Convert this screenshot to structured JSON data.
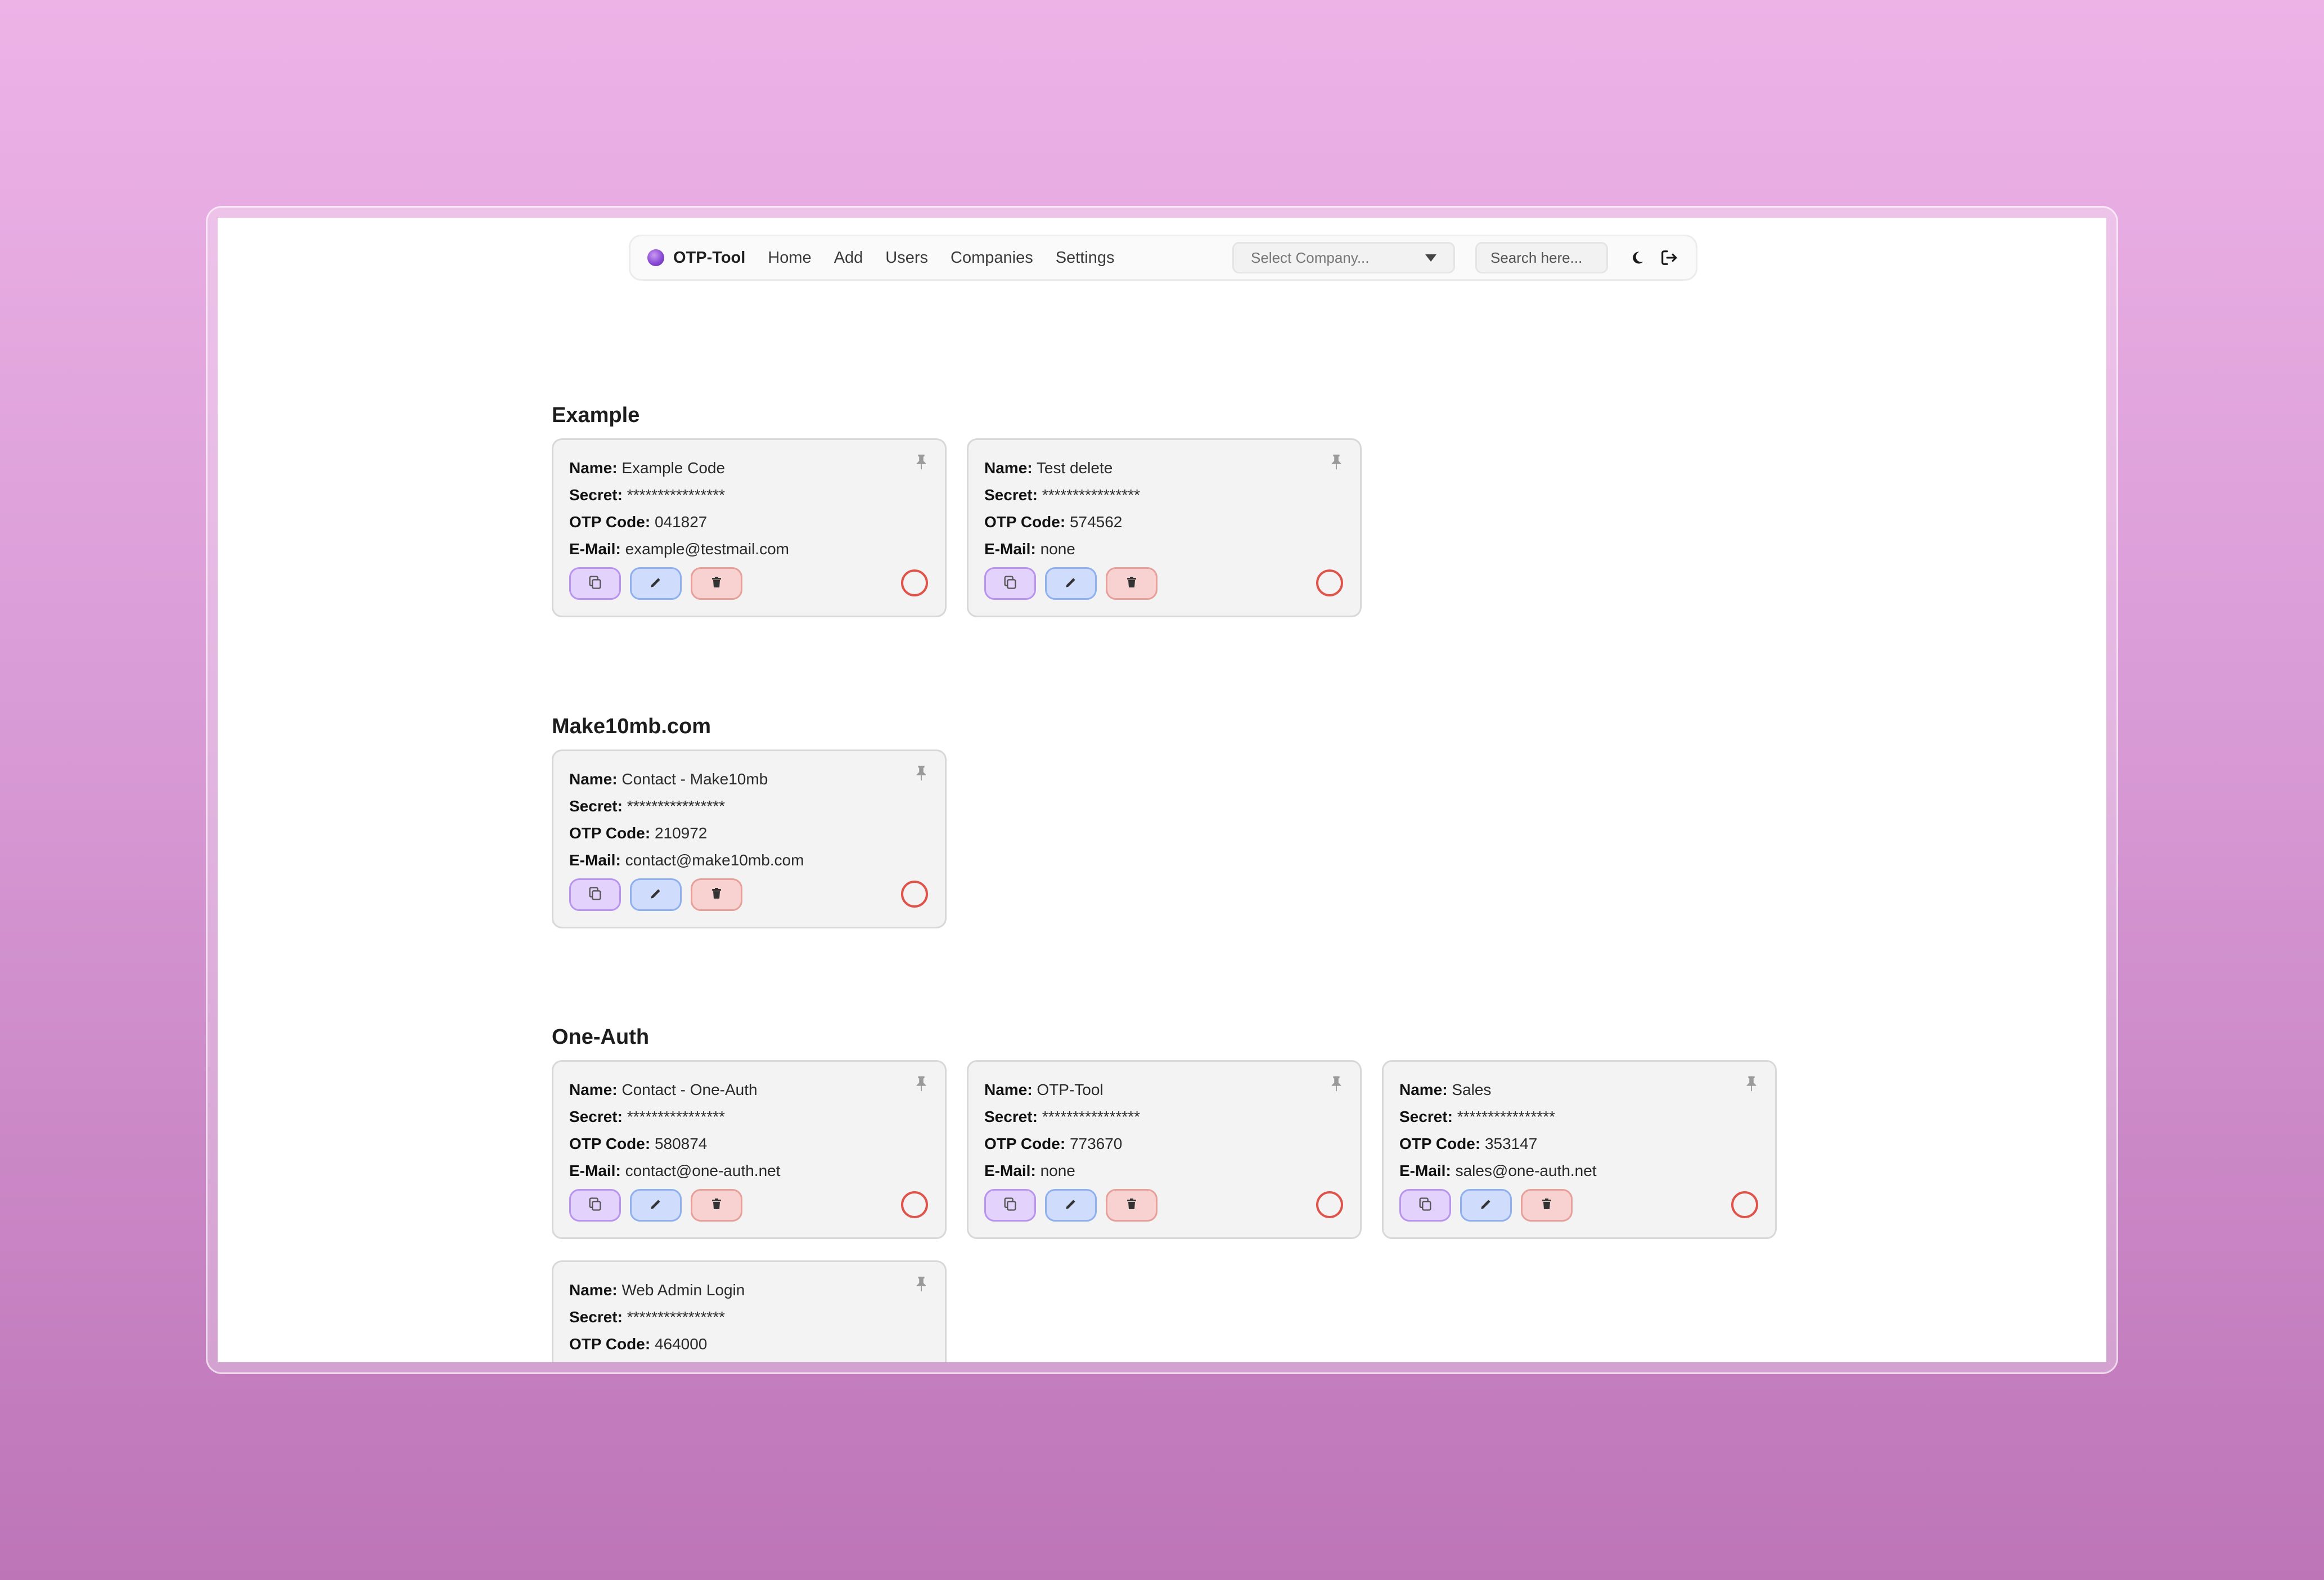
{
  "nav": {
    "brand": "OTP-Tool",
    "links": [
      "Home",
      "Add",
      "Users",
      "Companies",
      "Settings"
    ],
    "company_select_placeholder": "Select Company...",
    "search_placeholder": "Search here..."
  },
  "labels": {
    "name": "Name:",
    "secret": "Secret:",
    "otp": "OTP Code:",
    "email": "E-Mail:"
  },
  "colors": {
    "accent_purple": "#8a4bd6",
    "copy_bg": "#e3d2fb",
    "edit_bg": "#cfdcfb",
    "delete_bg": "#f8d2d0",
    "timer_red": "#e0534a"
  },
  "sections": [
    {
      "title": "Example",
      "cards": [
        {
          "name": "Example Code",
          "secret": "****************",
          "otp": "041827",
          "email": "example@testmail.com"
        },
        {
          "name": "Test delete",
          "secret": "****************",
          "otp": "574562",
          "email": "none"
        }
      ]
    },
    {
      "title": "Make10mb.com",
      "cards": [
        {
          "name": "Contact - Make10mb",
          "secret": "****************",
          "otp": "210972",
          "email": "contact@make10mb.com"
        }
      ]
    },
    {
      "title": "One-Auth",
      "cards": [
        {
          "name": "Contact - One-Auth",
          "secret": "****************",
          "otp": "580874",
          "email": "contact@one-auth.net"
        },
        {
          "name": "OTP-Tool",
          "secret": "****************",
          "otp": "773670",
          "email": "none"
        },
        {
          "name": "Sales",
          "secret": "****************",
          "otp": "353147",
          "email": "sales@one-auth.net"
        },
        {
          "name": "Web Admin Login",
          "secret": "****************",
          "otp": "464000",
          "email": ""
        }
      ]
    }
  ],
  "icons": {
    "pin": "pin-icon",
    "copy": "copy-icon",
    "edit": "pencil-icon",
    "delete": "trash-icon",
    "timer": "countdown-ring-icon",
    "theme": "moon-icon",
    "logout": "logout-icon"
  }
}
